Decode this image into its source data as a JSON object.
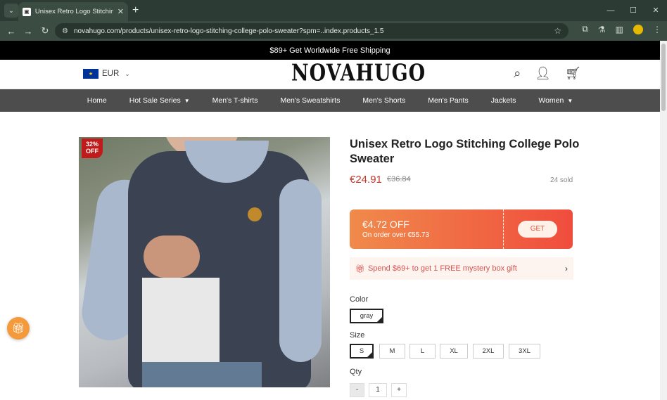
{
  "browser": {
    "tab_title": "Unisex Retro Logo Stitching Co",
    "url": "novahugo.com/products/unisex-retro-logo-stitching-college-polo-sweater?spm=..index.products_1.5"
  },
  "announcement": "$89+ Get Worldwide Free Shipping",
  "header": {
    "currency": "EUR",
    "logo": "NOVAHUGO"
  },
  "nav": [
    {
      "label": "Home"
    },
    {
      "label": "Hot Sale Series"
    },
    {
      "label": "Men's T-shirts"
    },
    {
      "label": "Men's Sweatshirts"
    },
    {
      "label": "Men's Shorts"
    },
    {
      "label": "Men's Pants"
    },
    {
      "label": "Jackets"
    },
    {
      "label": "Women"
    }
  ],
  "product": {
    "discount_badge_pct": "32%",
    "discount_badge_off": "OFF",
    "title": "Unisex Retro Logo Stitching College Polo Sweater",
    "price": "€24.91",
    "old_price": "€36.84",
    "sold": "24 sold",
    "coupon": {
      "amount": "€4.72 OFF",
      "condition": "On order over €55.73",
      "button": "GET"
    },
    "promo": "Spend $69+ to get 1 FREE mystery box gift",
    "color_label": "Color",
    "colors": [
      "gray"
    ],
    "selected_color": "gray",
    "size_label": "Size",
    "sizes": [
      "S",
      "M",
      "L",
      "XL",
      "2XL",
      "3XL"
    ],
    "selected_size": "S",
    "qty_label": "Qty",
    "qty": {
      "minus": "-",
      "value": "1",
      "plus": "+"
    }
  },
  "colors": {
    "nav_bg": "#4d4d4d",
    "price": "#c0392b",
    "coupon_start": "#f08a4b",
    "coupon_end": "#f04d3d",
    "badge": "#c01b1b"
  }
}
